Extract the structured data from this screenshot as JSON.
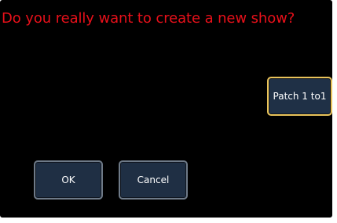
{
  "dialog": {
    "prompt": "Do you really want to create a new show?",
    "buttons": {
      "patch_line1": "Patch 1 to",
      "patch_line2": "1",
      "ok_label": "OK",
      "cancel_label": "Cancel"
    }
  },
  "colors": {
    "background": "#000000",
    "prompt_text": "#e8101a",
    "button_fill": "#1f2f44",
    "button_border": "#6e7a88",
    "selected_border": "#e9c35a"
  }
}
